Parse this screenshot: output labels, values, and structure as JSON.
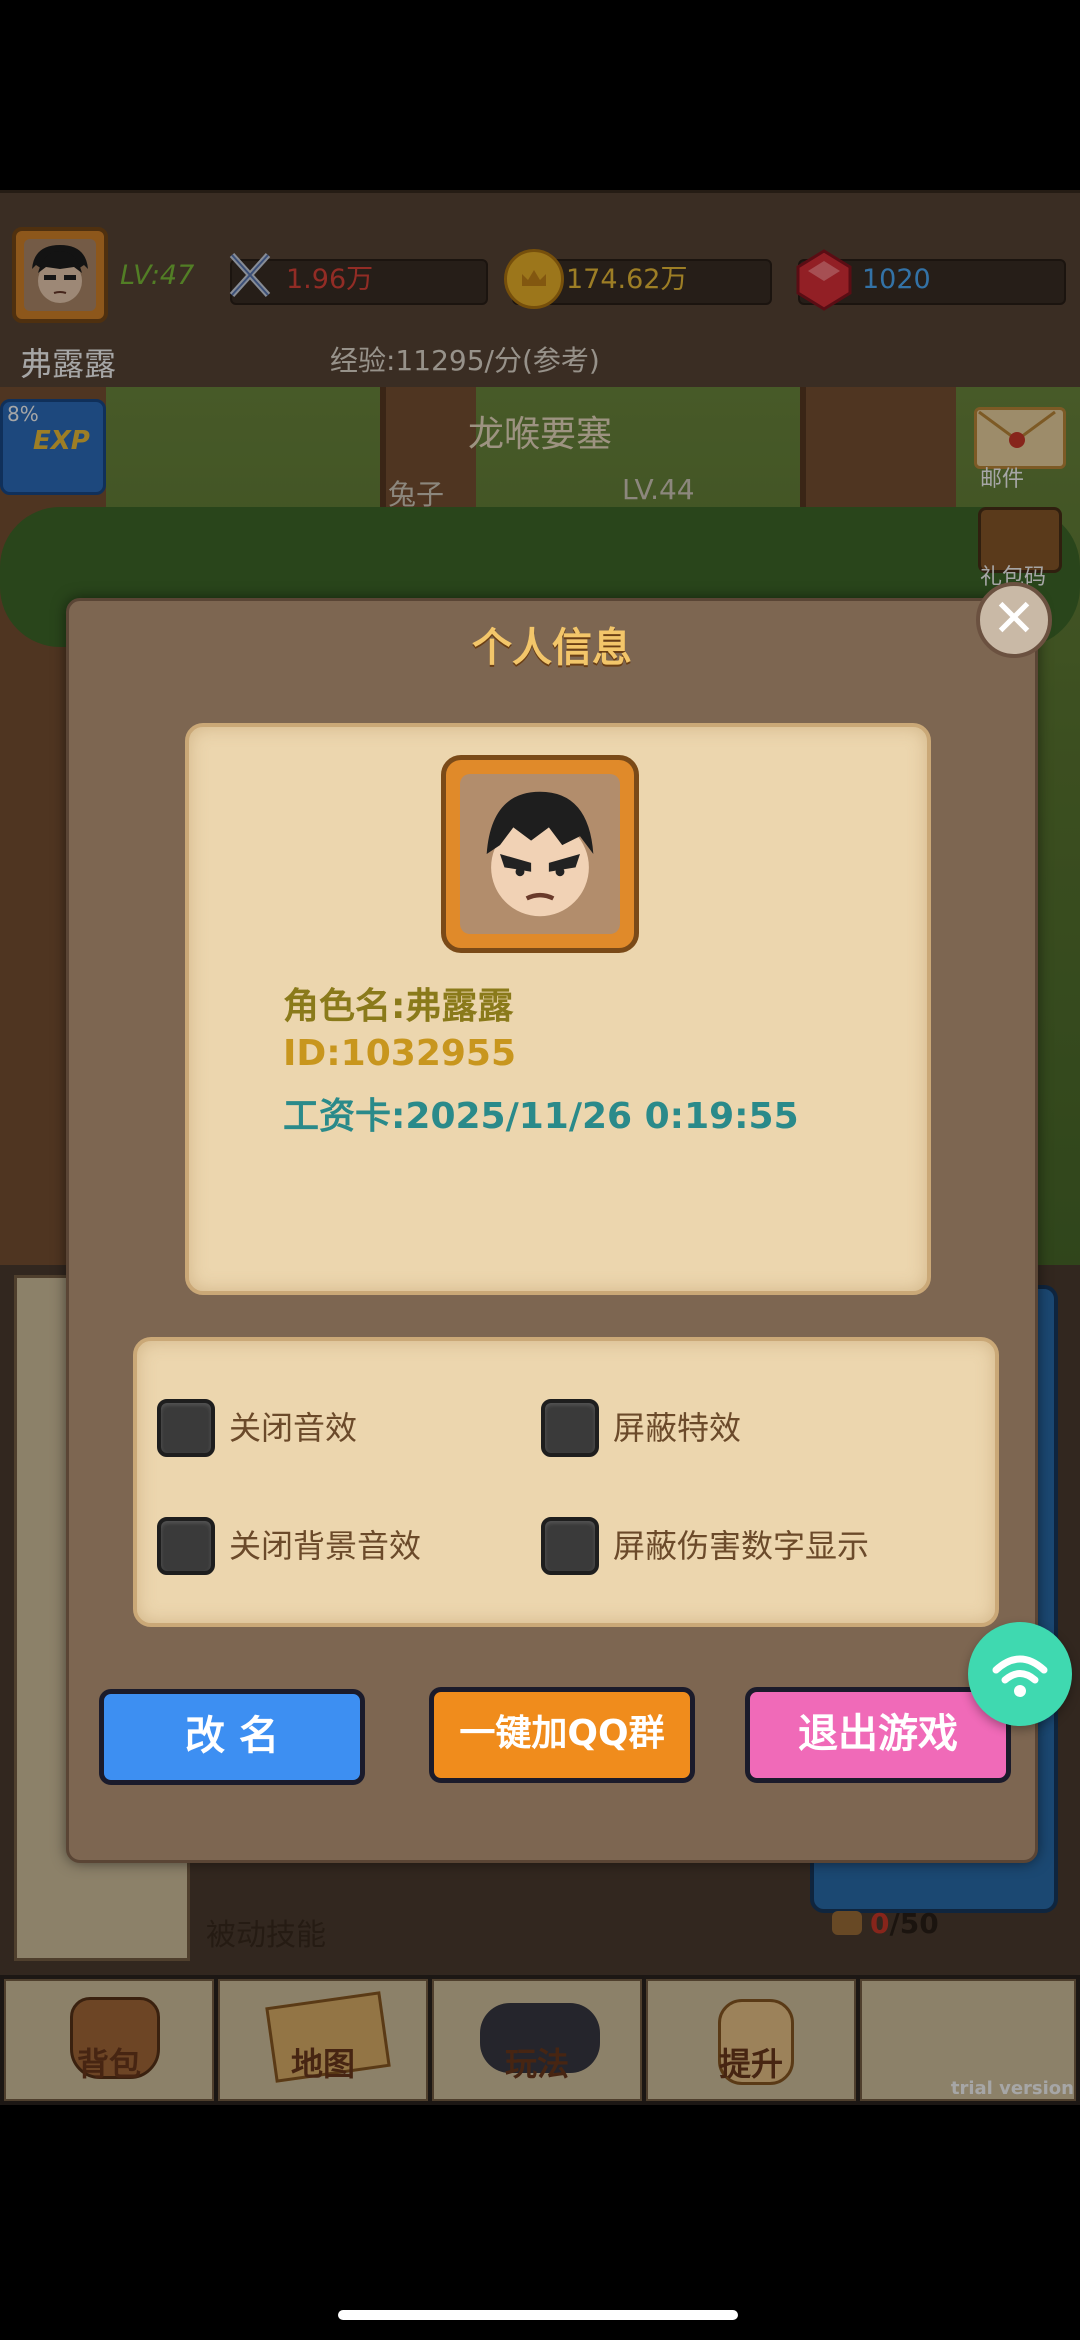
{
  "hud": {
    "level": "LV:47",
    "player_name": "弗露露",
    "power": "1.96万",
    "gold": "174.62万",
    "gems": "1020",
    "exp_rate": "经验:11295/分(参考)"
  },
  "scene": {
    "map_name": "龙喉要塞",
    "enemy_name": "兔子",
    "enemy_level": "LV.44",
    "mail_label": "邮件",
    "gift_label": "礼包码",
    "exp_badge": "EXP",
    "percent_badge": "8%"
  },
  "modal": {
    "title": "个人信息",
    "info": {
      "role_name": "角色名:弗露露",
      "id": "ID:1032955",
      "salary_card": "工资卡:2025/11/26 0:19:55"
    },
    "settings": [
      {
        "label": "关闭音效",
        "checked": false
      },
      {
        "label": "屏蔽特效",
        "checked": false
      },
      {
        "label": "关闭背景音效",
        "checked": false
      },
      {
        "label": "屏蔽伤害数字显示",
        "checked": false
      }
    ],
    "buttons": {
      "rename": "改 名",
      "join_qq": "一键加QQ群",
      "exit_game": "退出游戏"
    }
  },
  "lower": {
    "passive_skill": "被动技能",
    "capacity_used": "0",
    "capacity_total": "/50"
  },
  "nav": {
    "bag": "背包",
    "map": "地图",
    "play": "玩法",
    "upgrade": "提升"
  },
  "watermark": "trial version",
  "colors": {
    "rename_button": "#3d8ff2",
    "qq_button": "#f08c1c",
    "exit_button": "#f06ab8",
    "info_role": "#8a7a1a",
    "info_id": "#c8961e",
    "info_salary": "#2a8a8a"
  }
}
